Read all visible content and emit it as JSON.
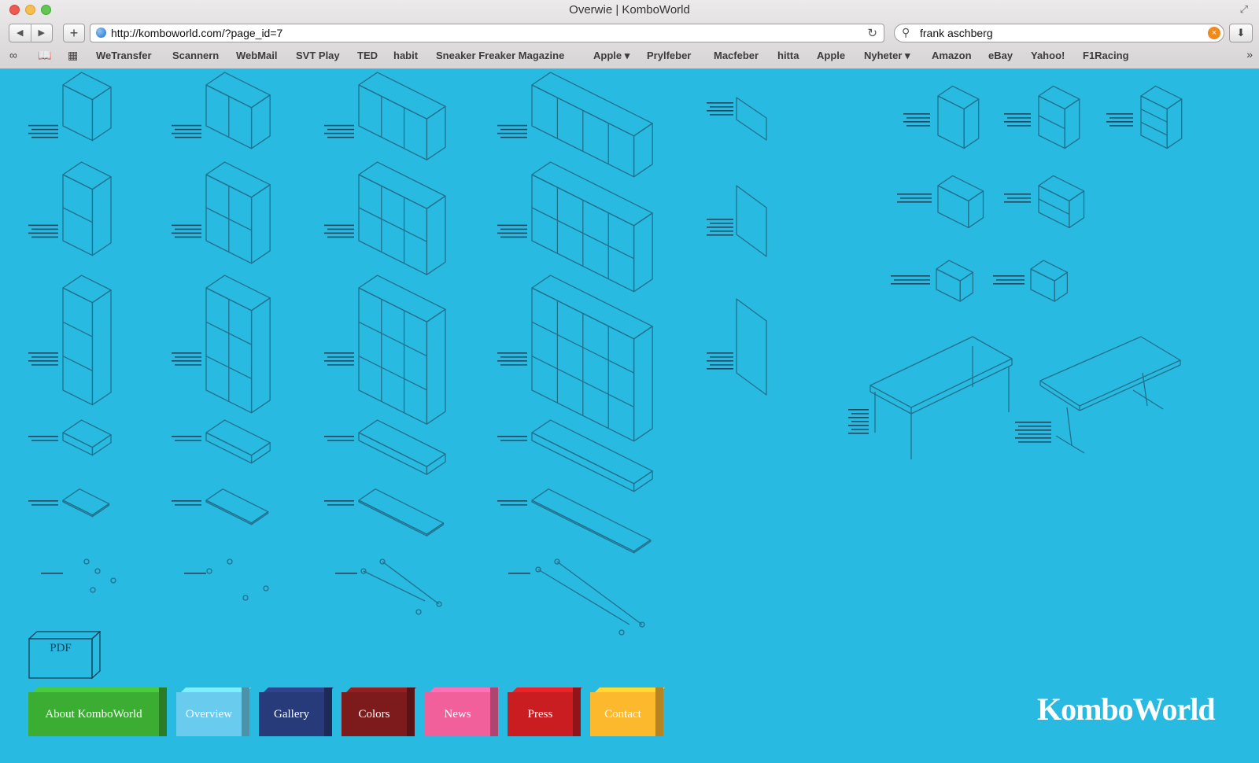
{
  "window": {
    "title": "Overwie | KomboWorld"
  },
  "toolbar": {
    "url": "http://komboworld.com/?page_id=7",
    "search_query": "frank aschberg"
  },
  "bookmarks": [
    "WeTransfer",
    "Scannern",
    "WebMail",
    "SVT Play",
    "TED",
    "habit",
    "Sneaker Freaker Magazine",
    "Apple ▾",
    "Prylfeber",
    "Macfeber",
    "hitta",
    "Apple",
    "Nyheter ▾",
    "Amazon",
    "eBay",
    "Yahoo!",
    "F1Racing"
  ],
  "pdf": {
    "label": "PDF"
  },
  "nav": [
    {
      "label": "About KomboWorld",
      "color": "#3cad33"
    },
    {
      "label": "Overview",
      "color": "#69cbed"
    },
    {
      "label": "Gallery",
      "color": "#273a79"
    },
    {
      "label": "Colors",
      "color": "#7d1a1c"
    },
    {
      "label": "News",
      "color": "#f2609b"
    },
    {
      "label": "Press",
      "color": "#c91d22"
    },
    {
      "label": "Contact",
      "color": "#fdb92e"
    }
  ],
  "logo": "KomboWorld",
  "colors": {
    "background": "#29bae2",
    "line": "#21708c"
  }
}
